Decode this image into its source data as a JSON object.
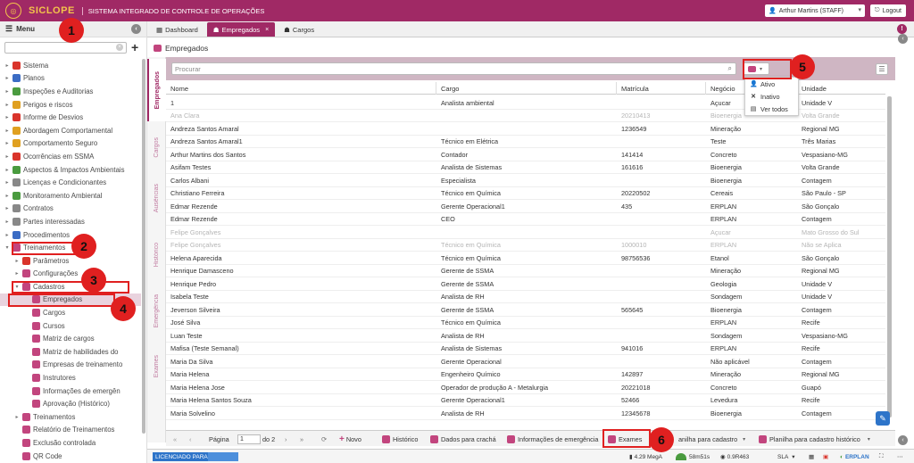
{
  "app": {
    "logo": "SICLOPE",
    "system_title": "SISTEMA INTEGRADO DE CONTROLE DE OPERAÇÕES",
    "user": "Arthur Martins (STAFF)",
    "logout": "Logout"
  },
  "sidebar": {
    "menu_label": "Menu",
    "search_placeholder": "",
    "items": [
      {
        "label": "Sistema",
        "arrow": "▸",
        "indent": 0,
        "color": "#d9342b"
      },
      {
        "label": "Planos",
        "arrow": "▸",
        "indent": 0,
        "color": "#3b6cc4"
      },
      {
        "label": "Inspeções e Auditorias",
        "arrow": "▸",
        "indent": 0,
        "color": "#4a9b3f"
      },
      {
        "label": "Perigos e riscos",
        "arrow": "▸",
        "indent": 0,
        "color": "#e0a020"
      },
      {
        "label": "Informe de Desvios",
        "arrow": "▸",
        "indent": 0,
        "color": "#d9342b"
      },
      {
        "label": "Abordagem Comportamental",
        "arrow": "▸",
        "indent": 0,
        "color": "#e0a020"
      },
      {
        "label": "Comportamento Seguro",
        "arrow": "▸",
        "indent": 0,
        "color": "#e0a020"
      },
      {
        "label": "Ocorrências em SSMA",
        "arrow": "▸",
        "indent": 0,
        "color": "#d9342b"
      },
      {
        "label": "Aspectos & Impactos Ambientais",
        "arrow": "▸",
        "indent": 0,
        "color": "#4a9b3f"
      },
      {
        "label": "Licenças e Condicionantes",
        "arrow": "▸",
        "indent": 0,
        "color": "#888888"
      },
      {
        "label": "Monitoramento Ambiental",
        "arrow": "▸",
        "indent": 0,
        "color": "#4a9b3f"
      },
      {
        "label": "Contratos",
        "arrow": "▸",
        "indent": 0,
        "color": "#888888"
      },
      {
        "label": "Partes interessadas",
        "arrow": "▸",
        "indent": 0,
        "color": "#888888"
      },
      {
        "label": "Procedimentos",
        "arrow": "▸",
        "indent": 0,
        "color": "#3b6cc4"
      },
      {
        "label": "Treinamentos",
        "arrow": "▾",
        "indent": 0,
        "color": "#c2457e"
      },
      {
        "label": "Parâmetros",
        "arrow": "▸",
        "indent": 1,
        "color": "#d9342b"
      },
      {
        "label": "Configurações",
        "arrow": "▸",
        "indent": 1,
        "color": "#c2457e"
      },
      {
        "label": "Cadastros",
        "arrow": "▾",
        "indent": 1,
        "color": "#c2457e"
      },
      {
        "label": "Empregados",
        "arrow": "",
        "indent": 2,
        "color": "#c2457e"
      },
      {
        "label": "Cargos",
        "arrow": "",
        "indent": 2,
        "color": "#c2457e"
      },
      {
        "label": "Cursos",
        "arrow": "",
        "indent": 2,
        "color": "#c2457e"
      },
      {
        "label": "Matriz de cargos",
        "arrow": "",
        "indent": 2,
        "color": "#c2457e"
      },
      {
        "label": "Matriz de habilidades do",
        "arrow": "",
        "indent": 2,
        "color": "#c2457e"
      },
      {
        "label": "Empresas de treinamento",
        "arrow": "",
        "indent": 2,
        "color": "#c2457e"
      },
      {
        "label": "Instrutores",
        "arrow": "",
        "indent": 2,
        "color": "#c2457e"
      },
      {
        "label": "Informações de emergên",
        "arrow": "",
        "indent": 2,
        "color": "#c2457e"
      },
      {
        "label": "Aprovação (Histórico)",
        "arrow": "",
        "indent": 2,
        "color": "#c2457e"
      },
      {
        "label": "Treinamentos",
        "arrow": "▸",
        "indent": 1,
        "color": "#c2457e"
      },
      {
        "label": "Relatório de Treinamentos",
        "arrow": "",
        "indent": 1,
        "color": "#c2457e"
      },
      {
        "label": "Exclusão controlada",
        "arrow": "",
        "indent": 1,
        "color": "#c2457e"
      },
      {
        "label": "QR Code",
        "arrow": "",
        "indent": 1,
        "color": "#c2457e"
      }
    ]
  },
  "tabs": [
    {
      "label": "Dashboard",
      "active": false
    },
    {
      "label": "Empregados",
      "active": true
    },
    {
      "label": "Cargos",
      "active": false
    }
  ],
  "page_title": "Empregados",
  "vtabs": [
    "Empregados",
    "Cargos",
    "Ausências",
    "Histórico",
    "Emergência",
    "Exames"
  ],
  "grid": {
    "search_placeholder": "Procurar",
    "columns": [
      "Nome",
      "Cargo",
      "Matrícula",
      "Negócio",
      "Unidade"
    ],
    "rows": [
      {
        "c": [
          "1",
          "Analista ambiental",
          "",
          "Açucar",
          "Unidade V"
        ],
        "inactive": false
      },
      {
        "c": [
          "Ana Clara",
          "",
          "20210413",
          "Bioenergia",
          "Volta Grande"
        ],
        "inactive": true
      },
      {
        "c": [
          "Andreza Santos Amaral",
          "",
          "1236549",
          "Mineração",
          "Regional MG"
        ],
        "inactive": false
      },
      {
        "c": [
          "Andreza Santos Amaral1",
          "Técnico em Elétrica",
          "",
          "Teste",
          "Três Marias"
        ],
        "inactive": false
      },
      {
        "c": [
          "Arthur Martins dos Santos",
          "Contador",
          "141414",
          "Concreto",
          "Vespasiano-MG"
        ],
        "inactive": false
      },
      {
        "c": [
          "Asifam Testes",
          "Analista de Sistemas",
          "161616",
          "Bioenergia",
          "Volta Grande"
        ],
        "inactive": false
      },
      {
        "c": [
          "Carlos Albani",
          "Especialista",
          "",
          "Bioenergia",
          "Contagem"
        ],
        "inactive": false
      },
      {
        "c": [
          "Christiano Ferreira",
          "Técnico em Química",
          "20220502",
          "Cereais",
          "São Paulo - SP"
        ],
        "inactive": false
      },
      {
        "c": [
          "Edmar Rezende",
          "Gerente Operacional1",
          "435",
          "ERPLAN",
          "São Gonçalo"
        ],
        "inactive": false
      },
      {
        "c": [
          "Edmar Rezende",
          "CEO",
          "",
          "ERPLAN",
          "Contagem"
        ],
        "inactive": false
      },
      {
        "c": [
          "Felipe Gonçalves",
          "",
          "",
          "Açucar",
          "Mato Grosso do Sul"
        ],
        "inactive": true
      },
      {
        "c": [
          "Felipe Gonçalves",
          "Técnico em Química",
          "1000010",
          "ERPLAN",
          "Não se Aplica"
        ],
        "inactive": true
      },
      {
        "c": [
          "Helena Aparecida",
          "Técnico em Química",
          "98756536",
          "Etanol",
          "São Gonçalo"
        ],
        "inactive": false
      },
      {
        "c": [
          "Henrique Damasceno",
          "Gerente de SSMA",
          "",
          "Mineração",
          "Regional MG"
        ],
        "inactive": false
      },
      {
        "c": [
          "Henrique Pedro",
          "Gerente de SSMA",
          "",
          "Geologia",
          "Unidade V"
        ],
        "inactive": false
      },
      {
        "c": [
          "Isabela Teste",
          "Analista de RH",
          "",
          "Sondagem",
          "Unidade V"
        ],
        "inactive": false
      },
      {
        "c": [
          "Jeverson Silveira",
          "Gerente de SSMA",
          "565645",
          "Bioenergia",
          "Contagem"
        ],
        "inactive": false
      },
      {
        "c": [
          "José Silva",
          "Técnico em Química",
          "",
          "ERPLAN",
          "Recife"
        ],
        "inactive": false
      },
      {
        "c": [
          "Luan Teste",
          "Analista de RH",
          "",
          "Sondagem",
          "Vespasiano-MG"
        ],
        "inactive": false
      },
      {
        "c": [
          "Mafisa (Teste Semanal)",
          "Analista de Sistemas",
          "941016",
          "ERPLAN",
          "Recife"
        ],
        "inactive": false
      },
      {
        "c": [
          "Maria Da Silva",
          "Gerente Operacional",
          "",
          "Não aplicável",
          "Contagem"
        ],
        "inactive": false
      },
      {
        "c": [
          "Maria Helena",
          "Engenheiro Químico",
          "142897",
          "Mineração",
          "Regional MG"
        ],
        "inactive": false
      },
      {
        "c": [
          "Maria Helena Jose",
          "Operador de produção A - Metalurgia",
          "20221018",
          "Concreto",
          "Guapó"
        ],
        "inactive": false
      },
      {
        "c": [
          "Maria Helena Santos Souza",
          "Gerente Operacional1",
          "52466",
          "Levedura",
          "Recife"
        ],
        "inactive": false
      },
      {
        "c": [
          "Maria Solvelino",
          "Analista de RH",
          "12345678",
          "Bioenergia",
          "Contagem"
        ],
        "inactive": false
      }
    ]
  },
  "filter_menu": [
    {
      "label": "Ativo",
      "icon": "person-icon"
    },
    {
      "label": "Inativo",
      "icon": "x-icon"
    },
    {
      "label": "Ver todos",
      "icon": "list-icon"
    }
  ],
  "bottombar": {
    "page_label": "Página",
    "page_value": "1",
    "of_label": "do 2",
    "new": "Novo",
    "history": "Histórico",
    "badge_data": "Dados para crachá",
    "emergency": "Informações de emergência",
    "exams": "Exames",
    "sheet": "anilha para cadastro",
    "sheet_history": "Planilha para cadastro histórico"
  },
  "statusbar": {
    "license": "LICENCIADO PARA:",
    "mem": "4.29 MegA",
    "time": "58m51s",
    "version": "0.9R463",
    "sla": "SLA",
    "brand": "ERPLAN"
  },
  "annotations": [
    "1",
    "2",
    "3",
    "4",
    "5",
    "6"
  ]
}
